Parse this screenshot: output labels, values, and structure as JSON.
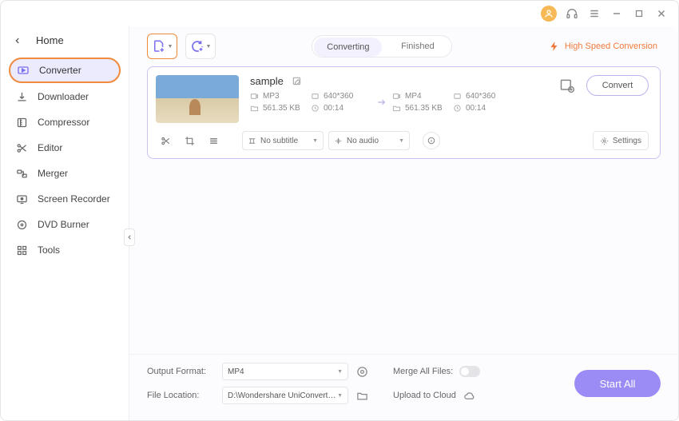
{
  "titlebar": {},
  "home_label": "Home",
  "sidebar": {
    "items": [
      {
        "label": "Converter"
      },
      {
        "label": "Downloader"
      },
      {
        "label": "Compressor"
      },
      {
        "label": "Editor"
      },
      {
        "label": "Merger"
      },
      {
        "label": "Screen Recorder"
      },
      {
        "label": "DVD Burner"
      },
      {
        "label": "Tools"
      }
    ]
  },
  "tabs": {
    "converting": "Converting",
    "finished": "Finished"
  },
  "hsc_label": "High Speed Conversion",
  "item": {
    "filename": "sample",
    "src": {
      "format": "MP3",
      "resolution": "640*360",
      "size": "561.35 KB",
      "duration": "00:14"
    },
    "dst": {
      "format": "MP4",
      "resolution": "640*360",
      "size": "561.35 KB",
      "duration": "00:14"
    },
    "subtitle": "No subtitle",
    "audio": "No audio",
    "settings_label": "Settings",
    "convert_label": "Convert"
  },
  "footer": {
    "output_format_label": "Output Format:",
    "output_format_value": "MP4",
    "file_location_label": "File Location:",
    "file_location_value": "D:\\Wondershare UniConverter 1",
    "merge_label": "Merge All Files:",
    "upload_label": "Upload to Cloud",
    "start_label": "Start All"
  }
}
